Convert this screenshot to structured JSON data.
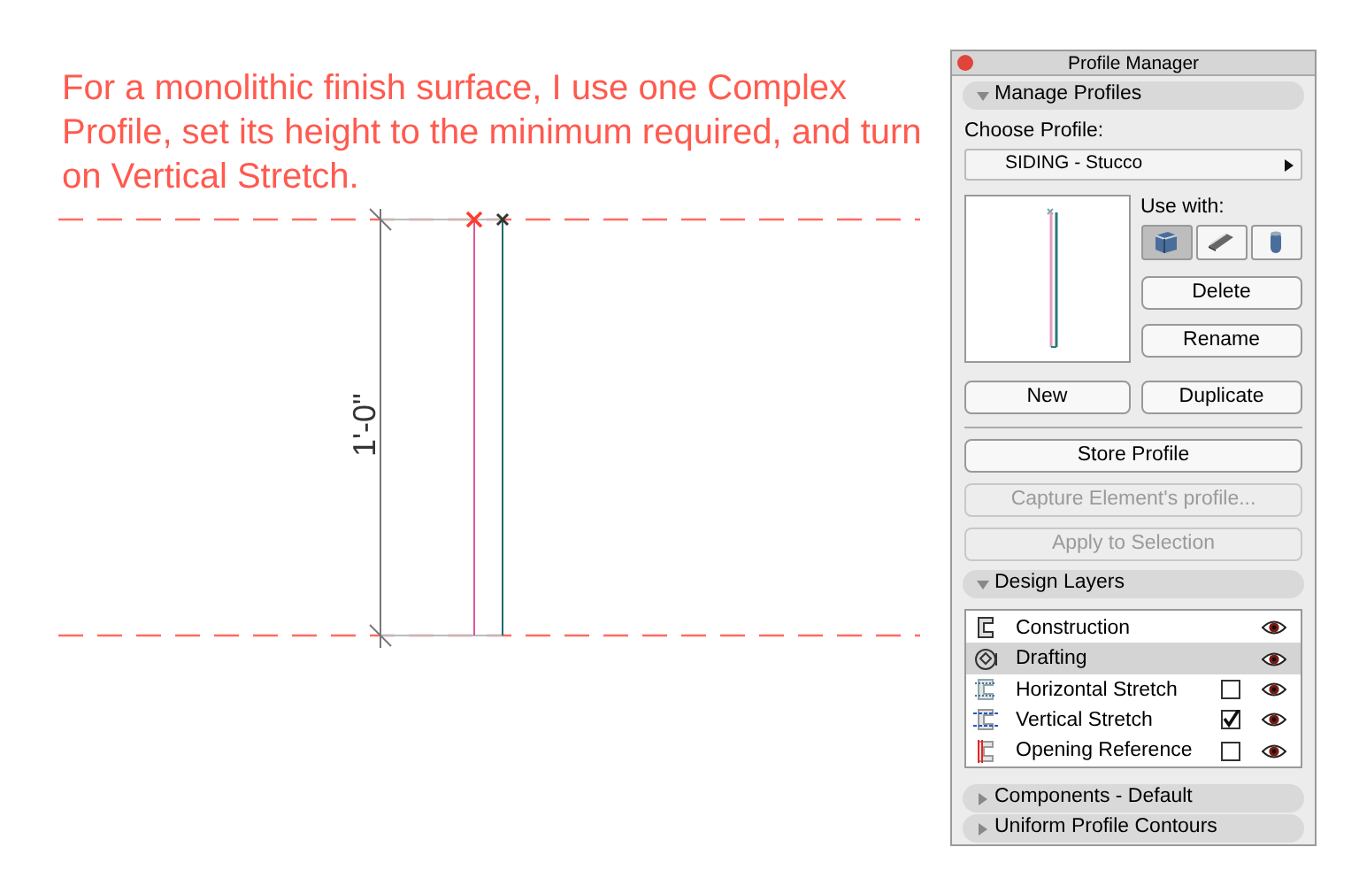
{
  "annotation": "For a monolithic finish surface, I use one Complex Profile, set its height to the minimum required, and turn on Vertical Stretch.",
  "dimension": "1'-0\"",
  "panel": {
    "title": "Profile Manager",
    "manage": {
      "label": "Manage Profiles",
      "expanded": true
    },
    "choose_label": "Choose Profile:",
    "profile": "SIDING - Stucco",
    "use_with_label": "Use with:",
    "use_with": [
      {
        "selected": true
      },
      {
        "selected": false
      },
      {
        "selected": false
      }
    ],
    "side_buttons": [
      "Delete",
      "Rename"
    ],
    "row_buttons": [
      "New",
      "Duplicate"
    ],
    "actions": [
      {
        "label": "Store Profile",
        "disabled": false
      },
      {
        "label": "Capture Element's profile...",
        "disabled": true
      },
      {
        "label": "Apply to Selection",
        "disabled": true
      }
    ],
    "layers_header": {
      "label": "Design Layers",
      "expanded": true
    },
    "layers": [
      {
        "label": "Construction",
        "kind": "plain",
        "selected": false,
        "visible": true
      },
      {
        "label": "Drafting",
        "kind": "plain",
        "selected": true,
        "visible": true
      },
      {
        "label": "Horizontal Stretch",
        "kind": "checkbox",
        "checked": false,
        "selected": false,
        "visible": true
      },
      {
        "label": "Vertical Stretch",
        "kind": "checkbox",
        "checked": true,
        "selected": false,
        "visible": true
      },
      {
        "label": "Opening Reference",
        "kind": "checkbox",
        "checked": false,
        "selected": false,
        "visible": true
      }
    ],
    "footer_sections": [
      {
        "label": "Components - Default",
        "expanded": false
      },
      {
        "label": "Uniform Profile Contours",
        "expanded": false
      }
    ]
  }
}
